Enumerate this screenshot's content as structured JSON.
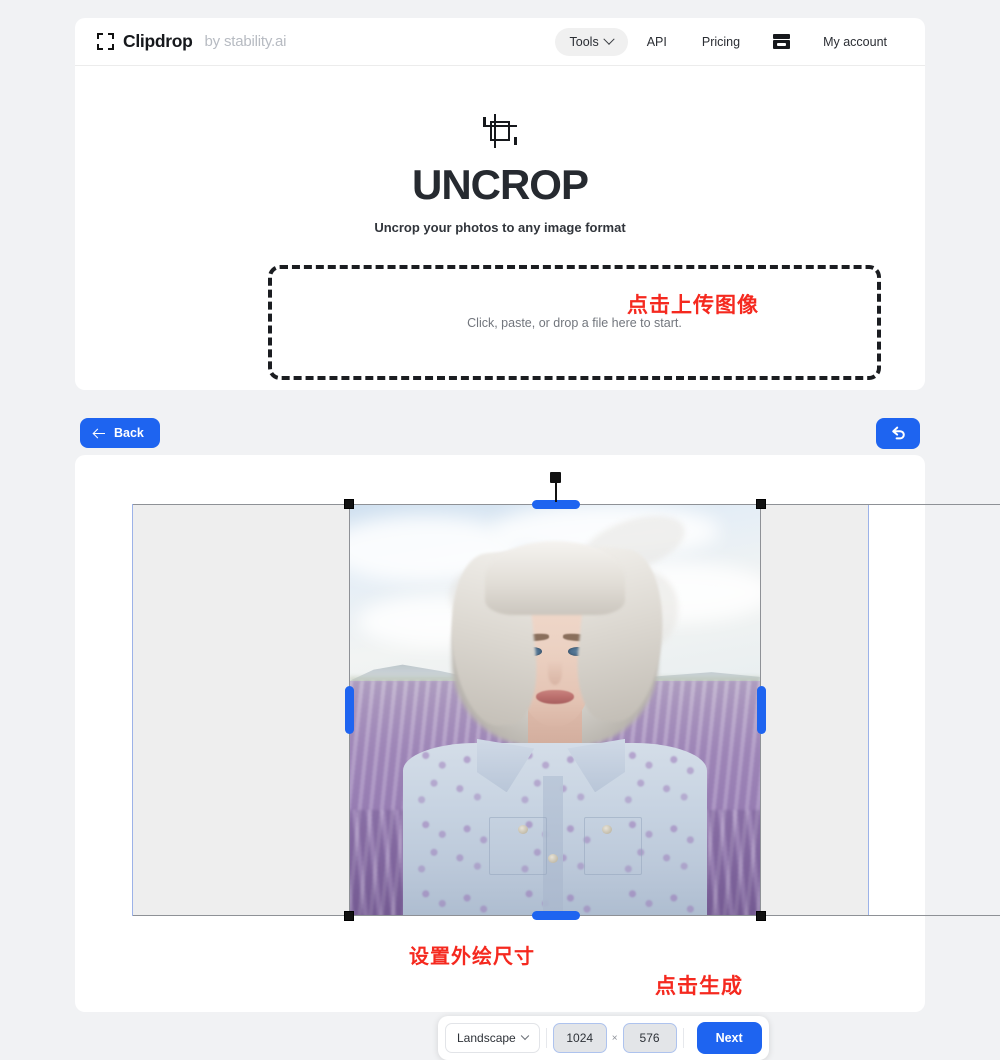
{
  "header": {
    "brand_name": "Clipdrop",
    "brand_by": "by stability.ai",
    "brand_logo_icon": "clipdrop-brackets-icon",
    "nav": {
      "tools_label": "Tools",
      "tools_chevron_icon": "chevron-down-icon",
      "api_label": "API",
      "pricing_label": "Pricing",
      "archive_icon": "archive-box-icon",
      "account_label": "My account"
    }
  },
  "hero": {
    "icon": "crop-tool-icon",
    "title": "UNCROP",
    "subtitle": "Uncrop your photos to any image format"
  },
  "dropzone": {
    "text": "Click, paste, or drop a file here to start.",
    "annotation": "点击上传图像"
  },
  "editor": {
    "back_label": "Back",
    "back_icon": "arrow-left-icon",
    "undo_icon": "undo-arrow-icon",
    "canvas": {
      "image_description": "Portrait of a woman with platinum blonde hair standing in a lavender field wearing a light blue floral shirt",
      "selection_handles": [
        "top-left",
        "top-right",
        "bottom-left",
        "bottom-right"
      ],
      "edge_handles": [
        "top",
        "bottom",
        "left",
        "right"
      ],
      "rotate_handle": "rotate-handle"
    },
    "controls": {
      "orientation_value": "Landscape",
      "orientation_chevron_icon": "chevron-down-icon",
      "width_value": "1024",
      "height_value": "576",
      "multiply_symbol": "×",
      "next_label": "Next"
    },
    "annotation_size": "设置外绘尺寸",
    "annotation_generate": "点击生成"
  },
  "colors": {
    "accent_blue": "#1e64f0",
    "annotation_red": "#f5291f",
    "page_background": "#f1f2f4",
    "card_background": "#ffffff",
    "canvas_background": "#eeeeee",
    "canvas_border": "#9cb2e8"
  }
}
